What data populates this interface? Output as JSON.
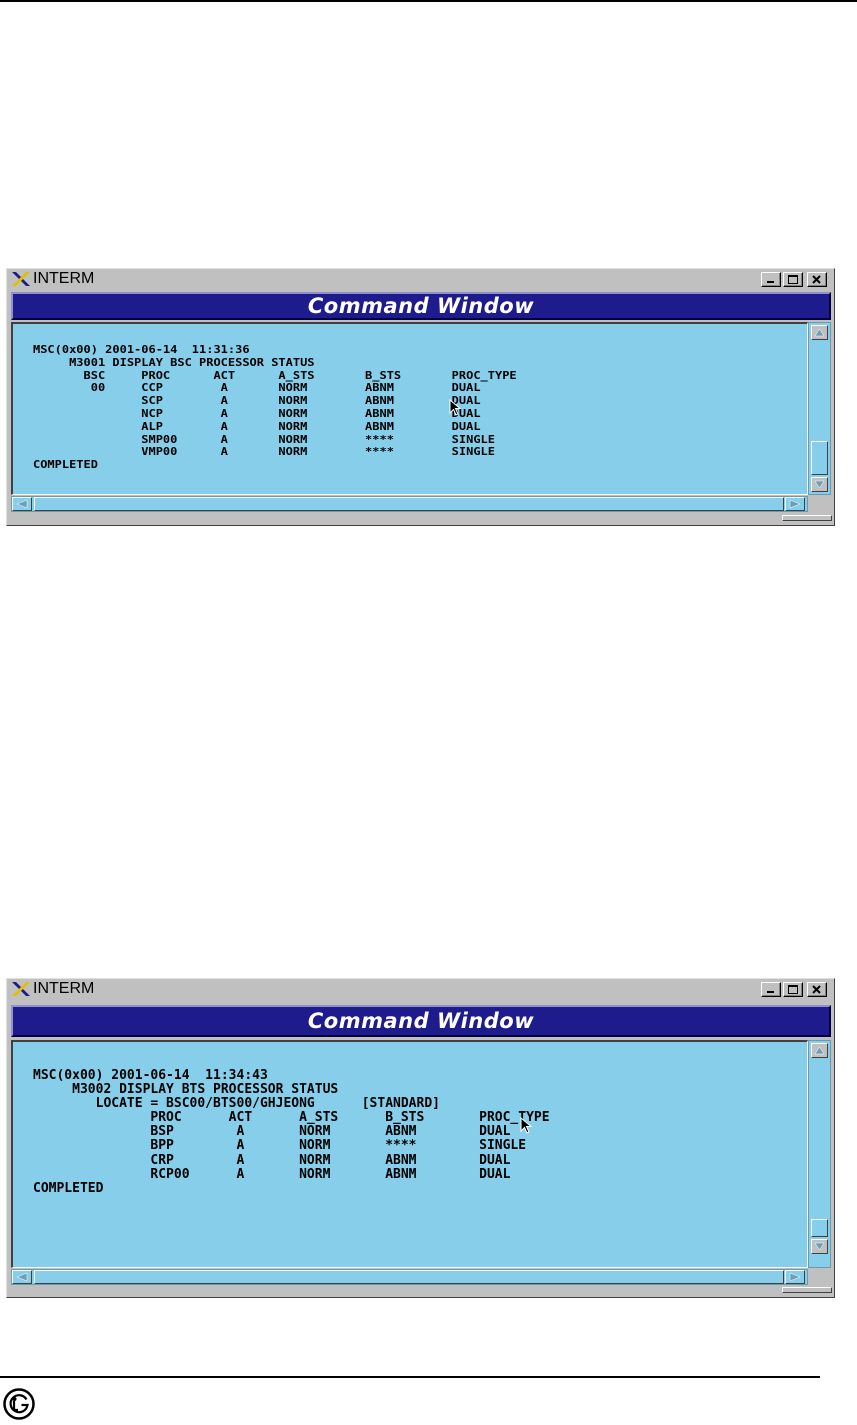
{
  "windows": [
    {
      "app_title": "INTERM",
      "header_title": "Command Window",
      "lines": [
        "MSC(0x00) 2001-06-14  11:31:36",
        "     M3001 DISPLAY BSC PROCESSOR STATUS",
        "       BSC     PROC      ACT      A_STS       B_STS       PROC_TYPE",
        "        00     CCP        A       NORM        ABNM        DUAL",
        "               SCP        A       NORM        ABNM        DUAL",
        "               NCP        A       NORM        ABNM        DUAL",
        "               ALP        A       NORM        ABNM        DUAL",
        "               SMP00      A       NORM        ****        SINGLE",
        "               VMP00      A       NORM        ****        SINGLE",
        "COMPLETED"
      ]
    },
    {
      "app_title": "INTERM",
      "header_title": "Command Window",
      "lines": [
        "MSC(0x00) 2001-06-14  11:34:43",
        "     M3002 DISPLAY BTS PROCESSOR STATUS",
        "        LOCATE = BSC00/BTS00/GHJEONG      [STANDARD]",
        "               PROC      ACT      A_STS      B_STS       PROC_TYPE",
        "               BSP        A       NORM       ABNM        DUAL",
        "               BPP        A       NORM       ****        SINGLE",
        "               CRP        A       NORM       ABNM        DUAL",
        "               RCP00      A       NORM       ABNM        DUAL",
        "COMPLETED"
      ]
    }
  ],
  "colors": {
    "terminal_bg": "#87ceeb",
    "header_bg": "#1e1c8c",
    "chrome": "#c0c0c0"
  },
  "icons": [
    "x-window-logo-icon",
    "minimize-icon",
    "maximize-icon",
    "close-icon",
    "scroll-up-icon",
    "scroll-down-icon",
    "scroll-left-icon",
    "scroll-right-icon",
    "mouse-pointer-icon",
    "lg-logo-icon"
  ]
}
